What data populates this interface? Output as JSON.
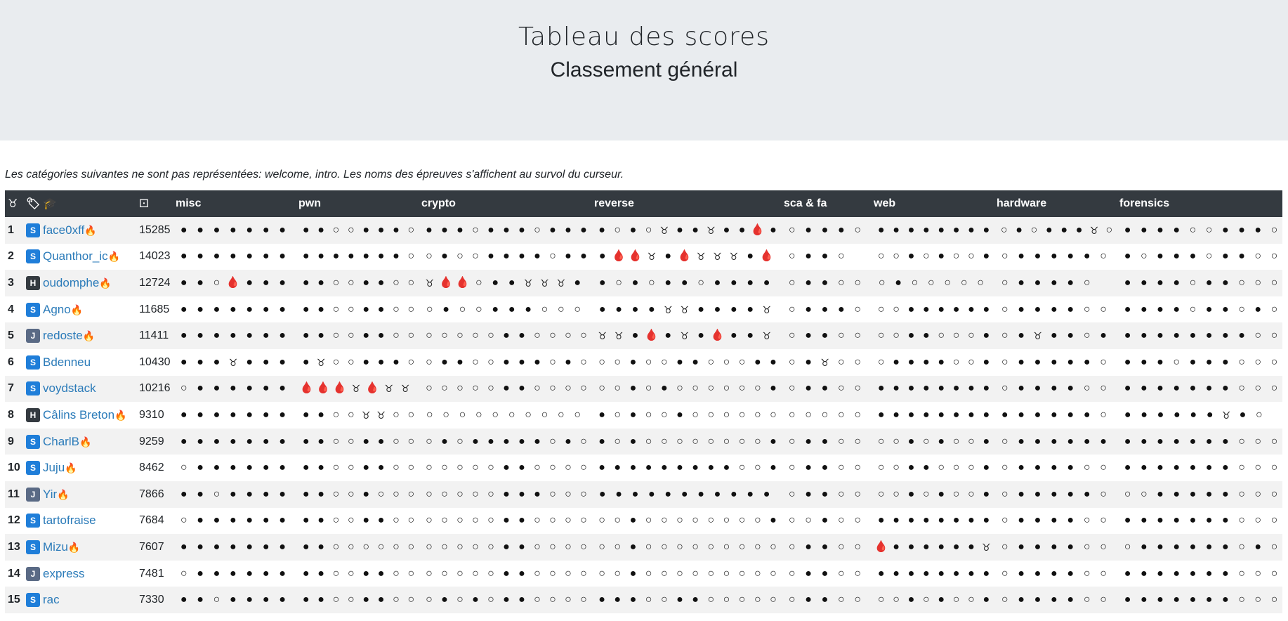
{
  "header": {
    "title": "Tableau des scores",
    "subtitle": "Classement général"
  },
  "note": "Les catégories suivantes ne sont pas représentées: welcome, intro. Les noms des épreuves s'affichent au survol du curseur.",
  "table_header": {
    "rank_icon": "medal-icon",
    "tags_icon": "tags-icon",
    "team_icon": "graduate-icon",
    "score_icon": "dice-icon",
    "categories": [
      "misc",
      "pwn",
      "crypto",
      "reverse",
      "sca & fa",
      "web",
      "hardware",
      "forensics"
    ]
  },
  "legend": {
    "s": "solved (●)",
    "u": "unsolved (○)",
    "b": "first blood (🩸)",
    "m": "medal (♉)"
  },
  "badge_colors": {
    "S": "#1f7ed9",
    "H": "#343a40",
    "J": "#5a6a85"
  },
  "fire_emoji": "🔥",
  "rows": [
    {
      "rank": "1",
      "badge": "S",
      "team": "face0xff",
      "fire": true,
      "score": "15285",
      "cells": [
        "sssssss",
        "ssuusssu",
        "sssusssusss",
        "susuassassbs",
        "usssu",
        "ssssssss",
        "ususssau",
        "ssssuusssu"
      ]
    },
    {
      "rank": "2",
      "badge": "S",
      "team": "Quanthor_ic",
      "fire": true,
      "score": "14023",
      "cells": [
        "sssssss",
        "sssssssu",
        "usuussssuss",
        "sbbasbaaasb",
        "ussu",
        "uususuus",
        "usssssu",
        "susssussuu"
      ]
    },
    {
      "rank": "3",
      "badge": "H",
      "team": "oudomphe",
      "fire": true,
      "score": "12724",
      "cells": [
        "ssubsss",
        "ssuussuu",
        "abbussaaas",
        "susussussss",
        "ussuu",
        "usuuuuu",
        "ussssu",
        "ssssussuuu"
      ]
    },
    {
      "rank": "4",
      "badge": "S",
      "team": "Agno",
      "fire": true,
      "score": "11685",
      "cells": [
        "sssssss",
        "ssuussuu",
        "usuusssuuu",
        "ssssaassssa",
        "usssu",
        "uussssss",
        "ussssuu",
        "ssssussusu"
      ]
    },
    {
      "rank": "5",
      "badge": "J",
      "team": "redoste",
      "fire": true,
      "score": "11411",
      "cells": [
        "sssssss",
        "ssuussuu",
        "uuuuussuuuu",
        "aasbsasbssa",
        "ussuu",
        "uussuuus",
        "usassus",
        "ssssssssuu"
      ]
    },
    {
      "rank": "6",
      "badge": "S",
      "team": "Bdenneu",
      "fire": false,
      "score": "10430",
      "cells": [
        "sssasss",
        "sauusssu",
        "ussuusssusu",
        "uusuussuuuss",
        "usauu",
        "ussssuus",
        "usssssu",
        "sssusssuuu"
      ]
    },
    {
      "rank": "7",
      "badge": "S",
      "team": "voydstack",
      "fire": false,
      "score": "10216",
      "cells": [
        "ussssss",
        "bbbabaa",
        "uuuuussuuuu",
        "uususuuuuuus",
        "ussuu",
        "ssssssss",
        "ussssuu",
        "sssssssuuu"
      ]
    },
    {
      "rank": "8",
      "badge": "H",
      "team": "Câlins Breton",
      "fire": true,
      "score": "9310",
      "cells": [
        "sssssss",
        "ssuuaauu",
        "uuuuuuuuuu",
        "susuusuuuuuu",
        "uuuuu",
        "ssssssss",
        "ssssssu",
        "ssssssasu"
      ]
    },
    {
      "rank": "9",
      "badge": "S",
      "team": "CharlB",
      "fire": true,
      "score": "9259",
      "cells": [
        "sssssss",
        "ssuussuu",
        "ususssssusu",
        "susuuuuuuuus",
        "ussuu",
        "uususuus",
        "ussssss",
        "sssssssuuu"
      ]
    },
    {
      "rank": "10",
      "badge": "S",
      "team": "Juju",
      "fire": true,
      "score": "8462",
      "cells": [
        "ussssss",
        "ssuussuu",
        "uuuuussuuuu",
        "sssssssssuus",
        "ussuu",
        "uussuuus",
        "ussssuu",
        "sssssssuuu"
      ]
    },
    {
      "rank": "11",
      "badge": "J",
      "team": "Yir",
      "fire": true,
      "score": "7866",
      "cells": [
        "ssussss",
        "ssuusuuu",
        "uuuuusssuuu",
        "sssssssssss",
        "ussuu",
        "uususuus",
        "usssssu",
        "uusssssuuu"
      ]
    },
    {
      "rank": "12",
      "badge": "S",
      "team": "tartofraise",
      "fire": false,
      "score": "7684",
      "cells": [
        "ussssss",
        "ssuussuu",
        "uuuuussuuuu",
        "uusuuuuuuuus",
        "uusuu",
        "ssssssss",
        "ussssuu",
        "sssssssuuu"
      ]
    },
    {
      "rank": "13",
      "badge": "S",
      "team": "Mizu",
      "fire": true,
      "score": "7607",
      "cells": [
        "sssssss",
        "ssuuuuuu",
        "uuuuussuuuu",
        "uusuuuuuuuuu",
        "ussuu",
        "bssssssa",
        "ussssuu",
        "ussssssusu"
      ]
    },
    {
      "rank": "14",
      "badge": "J",
      "team": "express",
      "fire": false,
      "score": "7481",
      "cells": [
        "ussssss",
        "ssuussuu",
        "uuuuussuuuu",
        "uusuuuuuuuuu",
        "ussuu",
        "ssssssss",
        "ussssuu",
        "sssssssuuu"
      ]
    },
    {
      "rank": "15",
      "badge": "S",
      "team": "rac",
      "fire": false,
      "score": "7330",
      "cells": [
        "ssussss",
        "ssuussuu",
        "ususussuuuu",
        "sssuussuuuuu",
        "ussuu",
        "uususuus",
        "ussssuu",
        "sssssssuuu"
      ]
    }
  ]
}
